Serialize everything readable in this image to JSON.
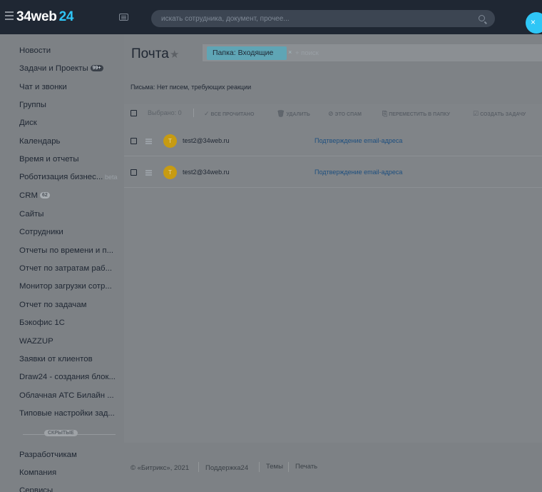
{
  "header": {
    "logo_main": "34web",
    "logo_num": "24",
    "search_placeholder": "искать сотрудника, документ, прочее...",
    "close_label": "×"
  },
  "sidebar": {
    "items": [
      {
        "label": "Новости"
      },
      {
        "label": "Задачи и Проекты",
        "badge": "99+"
      },
      {
        "label": "Чат и звонки"
      },
      {
        "label": "Группы"
      },
      {
        "label": "Диск"
      },
      {
        "label": "Календарь"
      },
      {
        "label": "Время и отчеты"
      },
      {
        "label": "Роботизация бизнес...",
        "tag": "beta"
      },
      {
        "label": "CRM",
        "badge": "62"
      },
      {
        "label": "Сайты"
      },
      {
        "label": "Сотрудники"
      },
      {
        "label": "Отчеты по времени и п..."
      },
      {
        "label": "Отчет по затратам раб..."
      },
      {
        "label": "Монитор загрузки сотр..."
      },
      {
        "label": "Отчет по задачам"
      },
      {
        "label": "Бэкофис 1С"
      },
      {
        "label": "WAZZUP"
      },
      {
        "label": "Заявки от клиентов"
      },
      {
        "label": "Draw24 - создания блок..."
      },
      {
        "label": "Облачная АТС Билайн ..."
      },
      {
        "label": "Типовые настройки зад..."
      }
    ],
    "hidden_label": "СКРЫТЫЕ",
    "bottom_items": [
      {
        "label": "Разработчикам"
      },
      {
        "label": "Компания"
      },
      {
        "label": "Сервисы"
      }
    ]
  },
  "page": {
    "title": "Почта",
    "filter_tag": "Папка: Входящие",
    "filter_tag_close": "×",
    "filter_search": "+ поиск",
    "info": "Письма: Нет писем, требующих реакции"
  },
  "toolbar": {
    "selected": "Выбрано: 0",
    "read_all": "ВСЕ ПРОЧИТАНО",
    "delete": "УДАЛИТЬ",
    "spam": "ЭТО СПАМ",
    "move": "ПЕРЕМЕСТИТЬ В ПАПКУ",
    "create_task": "СОЗДАТЬ ЗАДАЧУ"
  },
  "messages": [
    {
      "avatar": "T",
      "from": "test2@34web.ru",
      "subject": "Подтверждение email-адреса"
    },
    {
      "avatar": "T",
      "from": "test2@34web.ru",
      "subject": "Подтверждение email-адреса"
    }
  ],
  "footer": {
    "copyright": "© «Битрикс», 2021",
    "support": "Поддержка24",
    "themes": "Темы",
    "print": "Печать"
  },
  "colors": {
    "topbar": "#1f2733",
    "accent": "#2fc6f6",
    "avatar": "#c79b12",
    "filter_tag": "#5fa5b5"
  }
}
